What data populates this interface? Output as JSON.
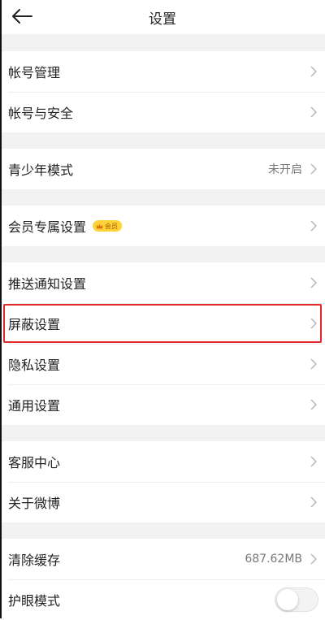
{
  "header": {
    "title": "设置",
    "back_icon": "arrow-left-icon"
  },
  "groups": [
    {
      "items": [
        {
          "label": "帐号管理"
        },
        {
          "label": "帐号与安全"
        }
      ]
    },
    {
      "items": [
        {
          "label": "青少年模式",
          "value": "未开启"
        }
      ]
    },
    {
      "items": [
        {
          "label": "会员专属设置",
          "badge": "会员"
        }
      ]
    },
    {
      "items": [
        {
          "label": "推送通知设置"
        },
        {
          "label": "屏蔽设置",
          "highlighted": true
        },
        {
          "label": "隐私设置"
        },
        {
          "label": "通用设置"
        }
      ]
    },
    {
      "items": [
        {
          "label": "客服中心"
        },
        {
          "label": "关于微博"
        }
      ]
    },
    {
      "items": [
        {
          "label": "清除缓存",
          "value": "687.62MB"
        },
        {
          "label": "护眼模式",
          "toggle": false
        }
      ]
    }
  ],
  "colors": {
    "highlight": "#e02a2a",
    "badge": "#ffd23a",
    "background": "#f2f2f2"
  }
}
